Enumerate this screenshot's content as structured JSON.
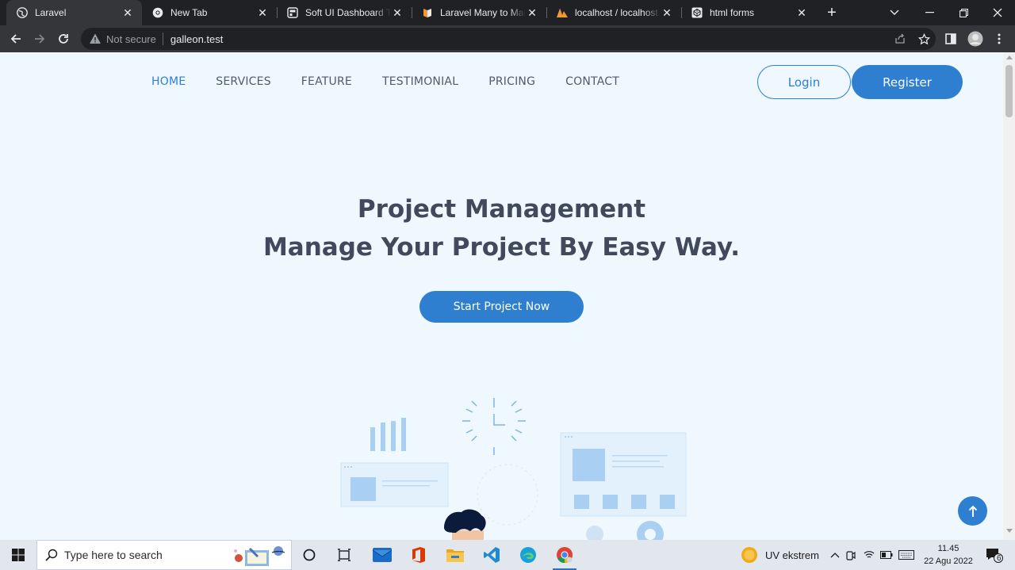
{
  "browser": {
    "tabs": [
      {
        "title": "Laravel",
        "icon": "globe-icon",
        "active": true
      },
      {
        "title": "New Tab",
        "icon": "chrome-icon",
        "active": false
      },
      {
        "title": "Soft UI Dashboard Tailwind",
        "icon": "dashboard-icon",
        "active": false
      },
      {
        "title": "Laravel Many to Many",
        "icon": "laracasts-icon",
        "active": false
      },
      {
        "title": "localhost / localhost / ",
        "icon": "phpmyadmin-icon",
        "active": false
      },
      {
        "title": "html forms",
        "icon": "codepen-icon",
        "active": false
      }
    ],
    "address": {
      "security": "Not secure",
      "url": "galleon.test"
    }
  },
  "page": {
    "nav": {
      "items": [
        "HOME",
        "SERVICES",
        "FEATURE",
        "TESTIMONIAL",
        "PRICING",
        "CONTACT"
      ],
      "active_index": 0
    },
    "auth": {
      "login_label": "Login",
      "register_label": "Register"
    },
    "hero": {
      "line1": "Project Management",
      "line2": "Manage Your Project By Easy Way.",
      "cta_label": "Start Project Now"
    },
    "colors": {
      "accent": "#2f7fd0",
      "background": "#eff8fe",
      "heading": "#404a5c"
    }
  },
  "taskbar": {
    "search_placeholder": "Type here to search",
    "weather": "UV ekstrem",
    "time": "11.45",
    "date": "22 Agu 2022",
    "notifications": "6"
  }
}
